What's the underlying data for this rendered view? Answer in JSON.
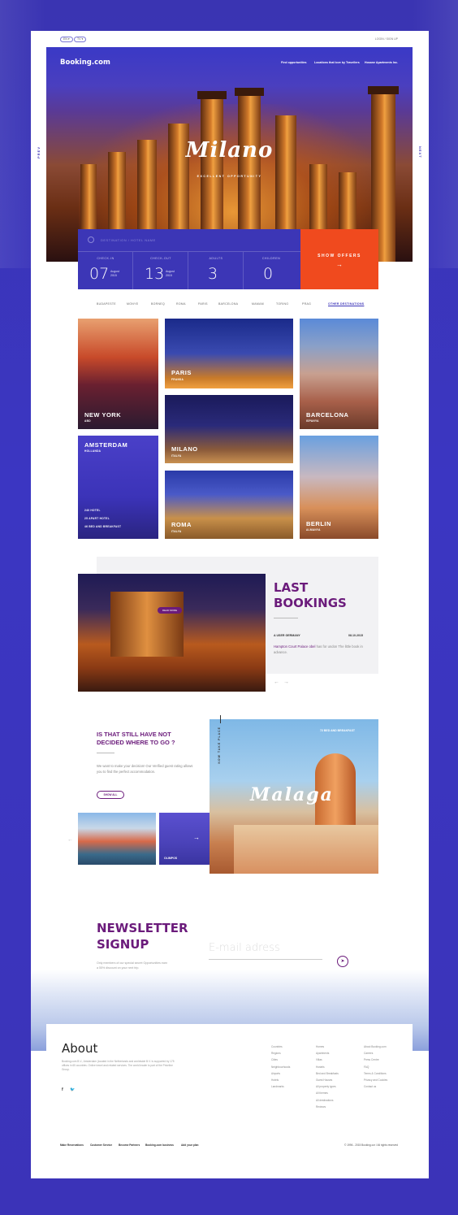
{
  "topbar": {
    "lang": "EN ▾",
    "currency": "TV ▾",
    "login": "LOGIN / SIGN UP"
  },
  "header": {
    "logo": "Booking.com",
    "nav": [
      "Find opportunities",
      "Locations that love by Travellers",
      "Hosane Apartments Inc."
    ]
  },
  "hero": {
    "city": "Milano",
    "tagline": "EXCELLENT OPPORTUNITY",
    "prev": "PREV",
    "next": "NEXT"
  },
  "search": {
    "placeholder": "DESTINATION / HOTEL NAME",
    "checkin": {
      "label": "CHECK-IN",
      "day": "07",
      "month": "August",
      "year": "2015"
    },
    "checkout": {
      "label": "CHECK-OUT",
      "day": "13",
      "month": "August",
      "year": "2015"
    },
    "adults": {
      "label": "ADULTS",
      "value": "3"
    },
    "children": {
      "label": "CHILDREN",
      "value": "0"
    },
    "button": "SHOW OFFERS",
    "button_arrow": "→"
  },
  "destinations": [
    "BUDAPESTE",
    "MONYE",
    "BORNEQ",
    "ROMA",
    "PARIS",
    "BARCELONA",
    "MAMAM",
    "TORINO",
    "PRAG"
  ],
  "other_destinations": "OTHER DESTINATIONS",
  "tiles": {
    "newyork": {
      "name": "NEW YORK",
      "country": "ABD"
    },
    "paris": {
      "name": "PARIS",
      "country": "FRANSA"
    },
    "barcelona": {
      "name": "BARCELONA",
      "country": "ISPANYA"
    },
    "amsterdam": {
      "name": "AMSTERDAM",
      "country": "HOLLANDA",
      "items": [
        "240 HOTEL",
        "25 APART HOTEL",
        "46 BED AND BREAKFAST"
      ]
    },
    "milano": {
      "name": "MILANO",
      "country": "ITALYA"
    },
    "roma": {
      "name": "ROMA",
      "country": "ITALYA"
    },
    "berlin": {
      "name": "BERLIN",
      "country": "ALMANYA"
    }
  },
  "bookings": {
    "title1": "LAST",
    "title2": "BOOKINGS",
    "user": "A USER GERMANY",
    "date": "08.10.2015",
    "text_link": "Hampton Court Palace obel",
    "text_rest": "has for undon The little book in advance.",
    "read_more": "READ MORE"
  },
  "decide": {
    "title": "IS THAT STILL HAVE NOT DECIDED WHERE TO GO ?",
    "text": "We want to make your decision! Our Verified guest rating allows you to find the perfect accommodation.",
    "button": "SHOW ALL",
    "thumb_label": "OLIMPOS",
    "vertical": "NOW TAKE PLACE",
    "malaga_tag": "72 BED AND BREAKFAST",
    "malaga_name": "Malaga"
  },
  "newsletter": {
    "title1": "NEWSLETTER",
    "title2": "SIGNUP",
    "text": "Only members of our special secret Opportunities earn a 55% discount on your next trip.",
    "placeholder": "E-mail adress"
  },
  "footer": {
    "about": "About",
    "text": "Booking.com B.V., Amsterdam (located in the Netherlands and worldwide B.V. is supported by 175 offices in 65 countries. Online travel and related services. The world leader is part of the Priceline Group.",
    "col1": [
      "Countries",
      "Regions",
      "Cities",
      "Neighbourhoods",
      "Airports",
      "Hotels",
      "Landmarks"
    ],
    "col2": [
      "Homes",
      "Apartments",
      "Villas",
      "Hostels",
      "Bed and Breakfasts",
      "Guest Houses",
      "All property types",
      "All themes",
      "All destinations",
      "Reviews"
    ],
    "col3": [
      "About Booking.com",
      "Careers",
      "Press Centre",
      "FAQ",
      "Terms & Conditions",
      "Privacy and Cookies",
      "Contact us"
    ],
    "col4": [
      "Car rental",
      "Flight finder",
      "Restaurant reservations",
      "Booking.com for Travel Agents"
    ],
    "bottom_links": [
      "Make Reservations",
      "Customer Service",
      "Become Partners",
      "Booking.com business",
      "Add your plan"
    ],
    "copyright": "© 1996 - 2015 Booking.cor / All rights reserved"
  },
  "colors": {
    "brand": "#3b33b8",
    "accent": "#f04a1e",
    "purple": "#6b1b7b"
  }
}
